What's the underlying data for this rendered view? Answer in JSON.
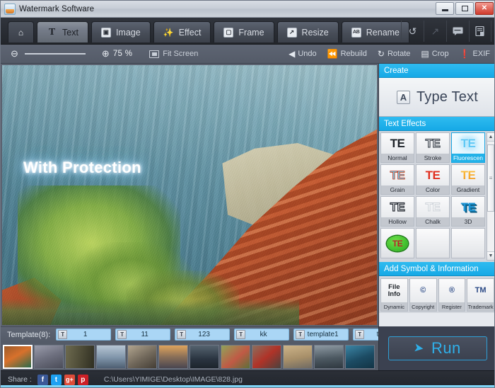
{
  "window": {
    "title": "Watermark Software",
    "icon": "app-icon",
    "controls": {
      "minimize": "minimize",
      "maximize": "maximize",
      "close": "close"
    }
  },
  "ribbon": {
    "tabs": [
      {
        "label": "",
        "icon": "home-icon",
        "active": false,
        "name": "tab-home"
      },
      {
        "label": "Text",
        "icon": "T",
        "active": true,
        "name": "tab-text"
      },
      {
        "label": "Image",
        "icon": "image-icon",
        "active": false,
        "name": "tab-image"
      },
      {
        "label": "Effect",
        "icon": "magic-wand-icon",
        "active": false,
        "name": "tab-effect"
      },
      {
        "label": "Frame",
        "icon": "frame-icon",
        "active": false,
        "name": "tab-frame"
      },
      {
        "label": "Resize",
        "icon": "resize-icon",
        "active": false,
        "name": "tab-resize"
      },
      {
        "label": "Rename",
        "icon": "AB",
        "active": false,
        "name": "tab-rename"
      }
    ],
    "right_buttons": [
      {
        "icon": "undo-arrow-icon",
        "glyph": "↶",
        "enabled": true,
        "name": "history-undo-button"
      },
      {
        "icon": "redo-arrow-icon",
        "glyph": "↷",
        "enabled": false,
        "name": "history-redo-button"
      },
      {
        "icon": "feedback-bubble-icon",
        "glyph": "⬜",
        "enabled": true,
        "name": "feedback-button"
      },
      {
        "icon": "register-document-icon",
        "glyph": "⬜",
        "enabled": true,
        "name": "register-button"
      }
    ]
  },
  "zoombar": {
    "zoom_out_icon": "zoom-out-icon",
    "zoom_in_icon": "zoom-in-icon",
    "zoom_value": "75 %",
    "fit_label": "Fit Screen",
    "actions": [
      {
        "label": "Undo",
        "icon": "undo-icon",
        "glyph": "◀",
        "name": "undo-button"
      },
      {
        "label": "Rebuild",
        "icon": "rebuild-icon",
        "glyph": "⏪",
        "name": "rebuild-button"
      },
      {
        "label": "Rotate",
        "icon": "rotate-icon",
        "glyph": "↻",
        "name": "rotate-button"
      },
      {
        "label": "Crop",
        "icon": "crop-icon",
        "glyph": "▣",
        "name": "crop-button"
      },
      {
        "label": "EXIF",
        "icon": "exif-icon",
        "glyph": "❗",
        "name": "exif-button"
      }
    ]
  },
  "canvas": {
    "watermark_text": "With Protection",
    "image_description": "red rock canyon with green tree"
  },
  "panel": {
    "create": {
      "header": "Create",
      "type_text_label": "Type Text",
      "type_text_icon": "A"
    },
    "text_effects": {
      "header": "Text Effects",
      "items": [
        {
          "name": "Normal",
          "preview": "TE",
          "style": "p-normal",
          "selected": false
        },
        {
          "name": "Stroke",
          "preview": "TE",
          "style": "p-stroke",
          "selected": false
        },
        {
          "name": "Fluorescen",
          "preview": "TE",
          "style": "p-fluor",
          "selected": true
        },
        {
          "name": "Grain",
          "preview": "TE",
          "style": "p-grain",
          "selected": false
        },
        {
          "name": "Color",
          "preview": "TE",
          "style": "p-color",
          "selected": false
        },
        {
          "name": "Gradient",
          "preview": "TE",
          "style": "p-grad",
          "selected": false
        },
        {
          "name": "Hollow",
          "preview": "TE",
          "style": "p-hollow",
          "selected": false
        },
        {
          "name": "Chalk",
          "preview": "TE",
          "style": "p-chalk",
          "selected": false
        },
        {
          "name": "3D",
          "preview": "TE",
          "style": "p-3d",
          "selected": false
        },
        {
          "name": "",
          "preview": "TE",
          "style": "p-blob",
          "selected": false
        }
      ],
      "scrollbar": {
        "up": "▲",
        "down": "▼"
      }
    },
    "symbols": {
      "header": "Add Symbol & Information",
      "items": [
        {
          "preview": "File\nInfo",
          "name": "Dynamic",
          "kind": "fileinfo"
        },
        {
          "preview": "©",
          "name": "Copyright",
          "kind": "sym"
        },
        {
          "preview": "®",
          "name": "Register",
          "kind": "sym"
        },
        {
          "preview": "TM",
          "name": "Trademark",
          "kind": "tm"
        }
      ]
    }
  },
  "template_bar": {
    "label": "Template(8):",
    "items": [
      {
        "name": "1"
      },
      {
        "name": "11"
      },
      {
        "name": "123"
      },
      {
        "name": "kk"
      },
      {
        "name": "template1"
      },
      {
        "name": "test"
      }
    ],
    "tools": [
      {
        "icon": "save-template-icon",
        "glyph": "💾",
        "name": "save-template-button"
      },
      {
        "icon": "manage-template-icon",
        "glyph": "🗊",
        "name": "manage-template-button"
      }
    ]
  },
  "thumbnails": {
    "count": 12,
    "selected_index": 0,
    "colors": [
      "#9a5a2a,#d8712c,#2b6b4a",
      "#8d8f9c,#6d6f7e,#4a4c58",
      "#6d6a4f,#4f4d38,#2f2e21",
      "#b7c6d4,#7e93a8,#4e5f72",
      "#9a8f7d,#70675a,#433d35",
      "#c98d4a,#8a6f58,#4a4650",
      "#3d4a58,#2a3440,#1d242c",
      "#8fa35a,#c05a45,#5c7039",
      "#8a6f5e,#b03328,#49423e",
      "#cdb489,#a78f69,#6f6a63",
      "#6e7c86,#4d5962,#2f3840",
      "#2c6a86,#1c4b63,#123445"
    ]
  },
  "run": {
    "label": "Run",
    "icon": "run-arrow-icon"
  },
  "status": {
    "share_label": "Share :",
    "socials": [
      {
        "name": "facebook",
        "glyph": "f",
        "cls": "fb"
      },
      {
        "name": "twitter",
        "glyph": "🐦",
        "cls": "tw"
      },
      {
        "name": "google-plus",
        "glyph": "g+",
        "cls": "gp"
      },
      {
        "name": "pinterest",
        "glyph": "p",
        "cls": "pin"
      }
    ],
    "file_path": "C:\\Users\\YIMIGE\\Desktop\\IMAGE\\828.jpg"
  },
  "colors": {
    "accent": "#16a9e6",
    "run_blue": "#2fb0ea",
    "panel_bg": "#d2d6dd",
    "chrome_dark": "#2e323a"
  }
}
